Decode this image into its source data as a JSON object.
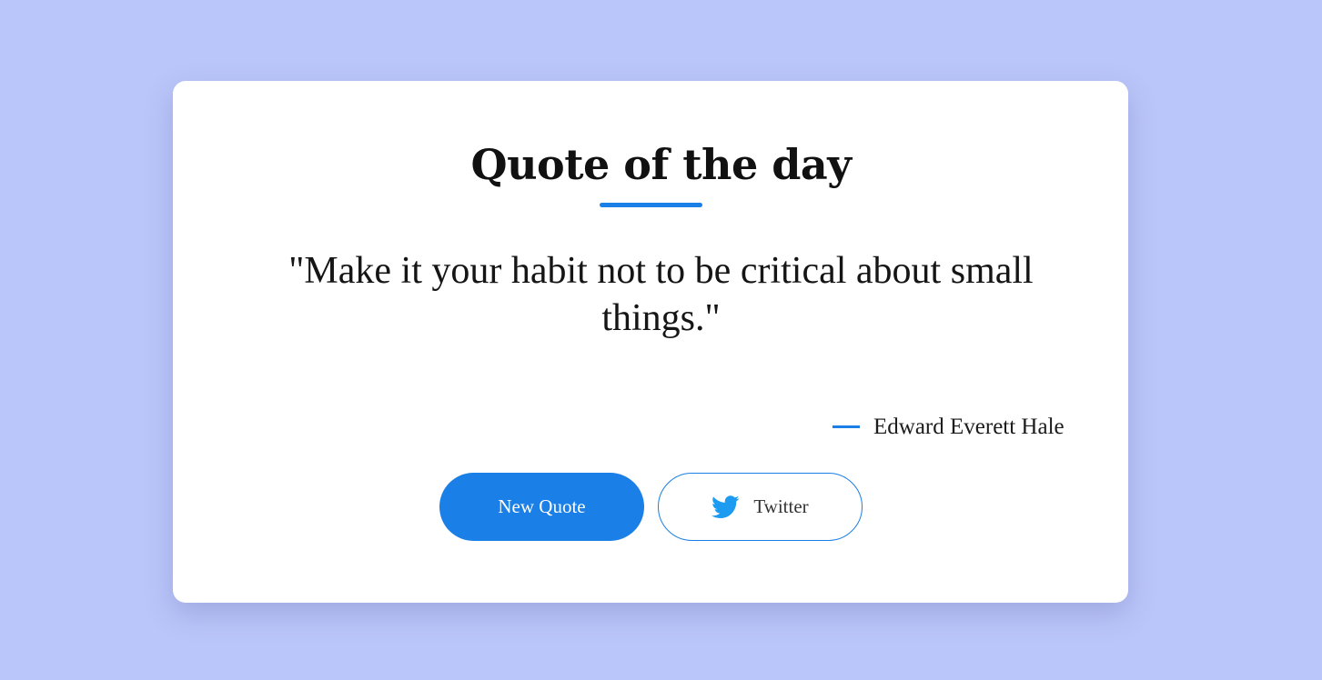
{
  "header": {
    "title": "Quote of the day"
  },
  "quote": {
    "text": "\"Make it your habit not to be critical about small things.\"",
    "author": "Edward Everett Hale"
  },
  "actions": {
    "new_quote_label": "New Quote",
    "twitter_label": "Twitter"
  },
  "icons": {
    "twitter": "twitter-icon"
  },
  "colors": {
    "background": "#bac5f9",
    "accent": "#1a7fe6",
    "twitter_blue": "#1d9bf0",
    "card": "#ffffff"
  }
}
